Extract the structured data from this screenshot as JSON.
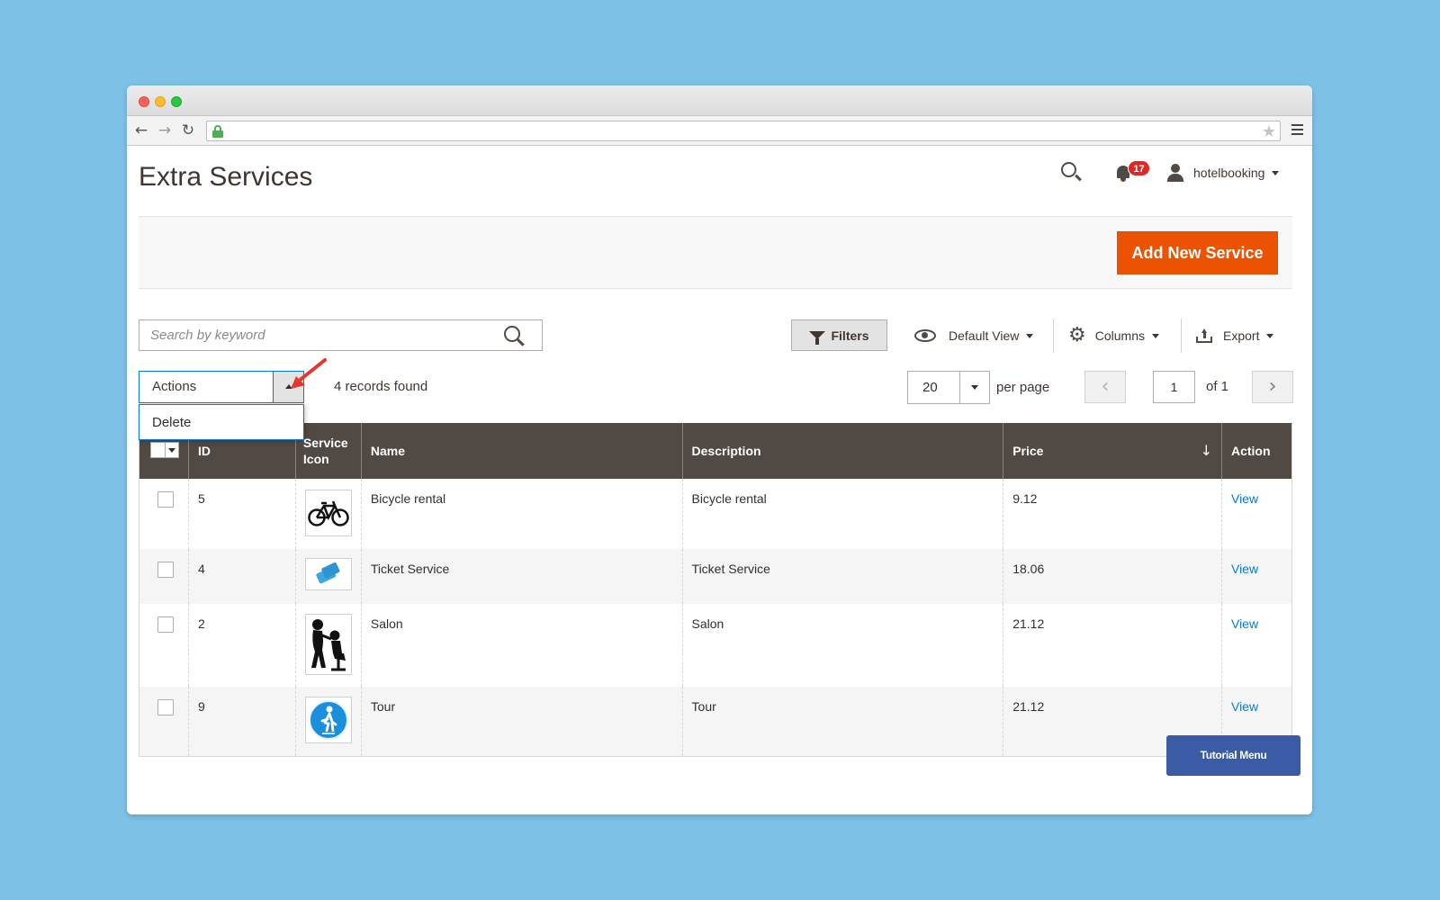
{
  "browser": {
    "url": ""
  },
  "header": {
    "title": "Extra Services",
    "notification_count": "17",
    "username": "hotelbooking"
  },
  "page_actions": {
    "add_button_label": "Add New Service"
  },
  "toolbar": {
    "search_placeholder": "Search by keyword",
    "filters_label": "Filters",
    "view_label": "Default View",
    "columns_label": "Columns",
    "export_label": "Export"
  },
  "mass_actions": {
    "selected_label": "Actions",
    "options": [
      "Delete"
    ]
  },
  "records_found": "4 records found",
  "pagination": {
    "per_page_value": "20",
    "per_page_label": "per page",
    "current_page": "1",
    "total_label": "of 1"
  },
  "grid": {
    "columns": [
      "ID",
      "Service Icon",
      "Name",
      "Description",
      "Price",
      "Action"
    ],
    "sort_indicator": "↓",
    "rows": [
      {
        "id": "5",
        "icon": "bicycle-icon",
        "name": "Bicycle rental",
        "description": "Bicycle rental",
        "price": "9.12",
        "action": "View"
      },
      {
        "id": "4",
        "icon": "ticket-icon",
        "name": "Ticket Service",
        "description": "Ticket Service",
        "price": "18.06",
        "action": "View"
      },
      {
        "id": "2",
        "icon": "salon-icon",
        "name": "Salon",
        "description": "Salon",
        "price": "21.12",
        "action": "View"
      },
      {
        "id": "9",
        "icon": "tour-icon",
        "name": "Tour",
        "description": "Tour",
        "price": "21.12",
        "action": "View"
      }
    ]
  },
  "tutorial_menu_label": "Tutorial Menu",
  "colors": {
    "accent_orange": "#eb5202",
    "grid_header": "#514943",
    "link_blue": "#007bdb",
    "tutorial_blue": "#3b5ba5",
    "background": "#7dc1e6"
  }
}
